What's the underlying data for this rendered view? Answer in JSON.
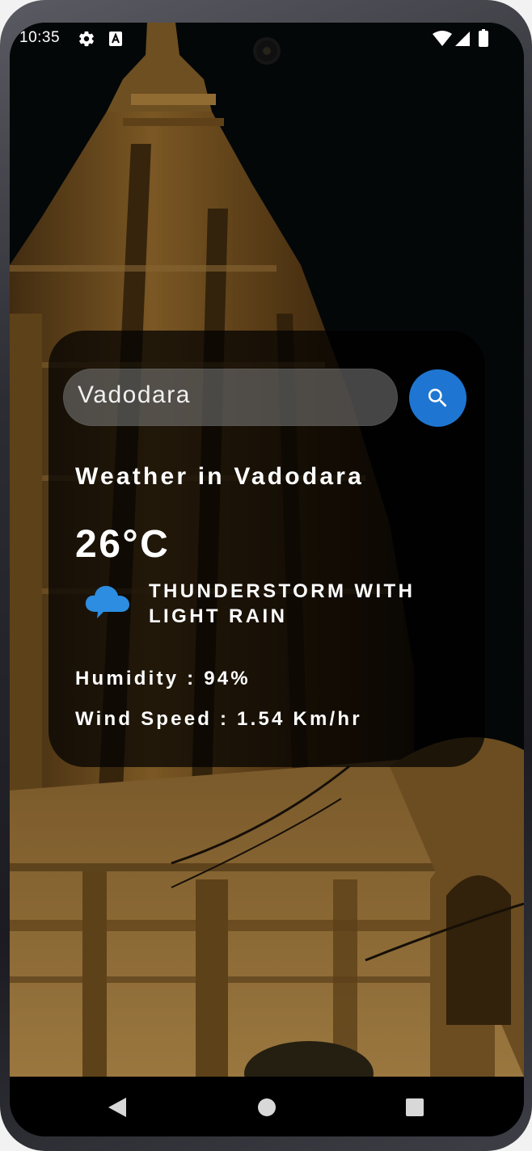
{
  "status_bar": {
    "time": "10:35",
    "icons": [
      "gear-icon",
      "font-a-icon",
      "wifi-icon",
      "signal-icon",
      "battery-icon"
    ]
  },
  "search": {
    "value": "Vadodara",
    "button_icon": "search-icon"
  },
  "weather": {
    "title": "Weather in Vadodara",
    "temperature": "26°C",
    "description": "Thunderstorm with light rain",
    "condition_icon": "cloud-icon",
    "humidity": "Humidity : 94%",
    "wind_speed": "Wind Speed : 1.54 Km/hr"
  },
  "navigation": {
    "back_icon": "back-triangle-icon",
    "home_icon": "home-circle-icon",
    "recents_icon": "recents-square-icon"
  },
  "colors": {
    "accent": "#1f76d2",
    "icon_blue": "#2d8de0",
    "card_background": "rgba(0,0,0,0.72)",
    "text": "#ffffff"
  }
}
